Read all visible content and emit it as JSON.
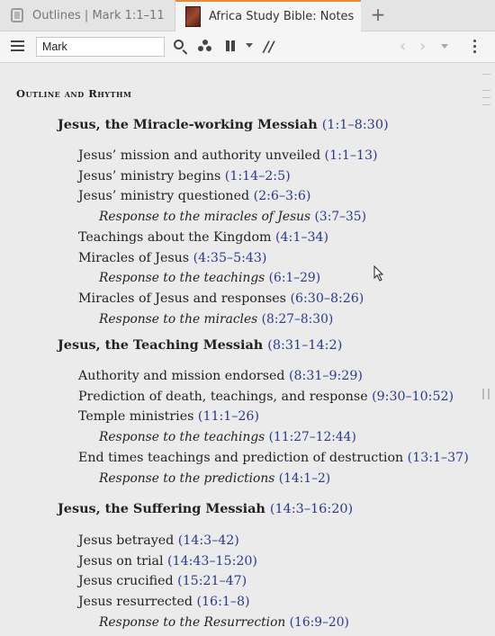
{
  "tabs": [
    {
      "label": "Outlines | Mark 1:1–11",
      "icon": "document-icon",
      "active": false
    },
    {
      "label": "Africa Study Bible: Notes",
      "icon": "book-cover-icon",
      "active": true
    }
  ],
  "toolbar": {
    "search_value": "Mark",
    "icons": [
      "menu-icon",
      "search-icon",
      "visual-filter-icon",
      "parallel-icon",
      "caret-down-icon",
      "text-compare-icon",
      "back-icon",
      "forward-icon",
      "history-caret-icon",
      "more-icon"
    ],
    "slash_label": "//"
  },
  "content": {
    "heading": "Outline and Rhythm",
    "sections": [
      {
        "title": "Jesus, the Miracle-working Messiah",
        "ref": "(1:1–8:30)",
        "items": [
          {
            "level": "sub",
            "text": "Jesus’ mission and authority unveiled",
            "ref": "(1:1–13)"
          },
          {
            "level": "sub",
            "text": "Jesus’ ministry begins",
            "ref": "(1:14–2:5)"
          },
          {
            "level": "sub",
            "text": "Jesus’ ministry questioned",
            "ref": "(2:6–3:6)"
          },
          {
            "level": "resp",
            "text": "Response to the miracles of Jesus",
            "ref": "(3:7–35)"
          },
          {
            "level": "sub",
            "text": "Teachings about the Kingdom",
            "ref": "(4:1–34)"
          },
          {
            "level": "sub",
            "text": "Miracles of Jesus",
            "ref": "(4:35–5:43)"
          },
          {
            "level": "resp",
            "text": "Response to the teachings",
            "ref": "(6:1–29)"
          },
          {
            "level": "sub",
            "text": "Miracles of Jesus and responses",
            "ref": "(6:30–8:26)"
          },
          {
            "level": "resp",
            "text": "Response to the miracles",
            "ref": "(8:27–8:30)"
          }
        ]
      },
      {
        "title": "Jesus, the Teaching Messiah",
        "ref": "(8:31–14:2)",
        "items": [
          {
            "level": "sub",
            "text": "Authority and mission endorsed",
            "ref": "(8:31–9:29)"
          },
          {
            "level": "sub",
            "text": "Prediction of death, teachings, and response",
            "ref": "(9:30–10:52)"
          },
          {
            "level": "sub",
            "text": "Temple ministries",
            "ref": "(11:1–26)"
          },
          {
            "level": "resp",
            "text": "Response to the teachings",
            "ref": "(11:27–12:44)"
          },
          {
            "level": "sub",
            "text": "End times teachings and prediction of destruction",
            "ref": "(13:1–37)"
          },
          {
            "level": "resp",
            "text": "Response to the predictions",
            "ref": "(14:1–2)"
          }
        ]
      },
      {
        "title": "Jesus, the Suffering Messiah",
        "ref": "(14:3–16:20)",
        "items": [
          {
            "level": "sub",
            "text": "Jesus betrayed",
            "ref": "(14:3–42)"
          },
          {
            "level": "sub",
            "text": "Jesus on trial",
            "ref": "(14:43–15:20)"
          },
          {
            "level": "sub",
            "text": "Jesus crucified",
            "ref": "(15:21–47)"
          },
          {
            "level": "sub",
            "text": "Jesus resurrected",
            "ref": "(16:1–8)"
          },
          {
            "level": "resp",
            "text": "Response to the Resurrection",
            "ref": "(16:9–20)"
          }
        ]
      }
    ]
  },
  "colors": {
    "link": "#2b3a8c",
    "active_tab_accent": "#e8883a",
    "background": "#ebebeb"
  }
}
